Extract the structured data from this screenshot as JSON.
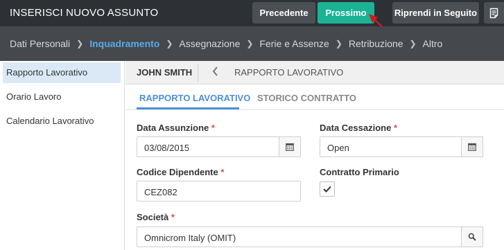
{
  "header": {
    "title": "INSERISCI NUOVO ASSUNTO",
    "prev_label": "Precedente",
    "next_label": "Prossimo",
    "later_label": "Riprendi in Seguito",
    "doc_icon": "document-icon",
    "accent_color": "#1ab394"
  },
  "breadcrumb": [
    {
      "label": "Dati Personali"
    },
    {
      "label": "Inquadramento"
    },
    {
      "label": "Assegnazione"
    },
    {
      "label": "Ferie e Assenze"
    },
    {
      "label": "Retribuzione"
    },
    {
      "label": "Altro"
    }
  ],
  "sidebar": {
    "items": [
      {
        "label": "Rapporto Lavorativo"
      },
      {
        "label": "Orario Lavoro"
      },
      {
        "label": "Calendario Lavorativo"
      }
    ]
  },
  "main": {
    "employee_name": "JOHN SMITH",
    "section_title": "RAPPORTO LAVORATIVO",
    "tabs": [
      {
        "label": "RAPPORTO LAVORATIVO"
      },
      {
        "label": "STORICO CONTRATTO"
      }
    ]
  },
  "form": {
    "hire_date": {
      "label": "Data Assunzione",
      "value": "03/08/2015"
    },
    "end_date": {
      "label": "Data Cessazione",
      "value": "Open"
    },
    "employee_code": {
      "label": "Codice Dipendente",
      "value": "CEZ082"
    },
    "primary_contract": {
      "label": "Contratto Primario",
      "checked": true
    },
    "company": {
      "label": "Società",
      "value": "Omnicrom Italy (OMIT)"
    },
    "required_mark": "*"
  }
}
